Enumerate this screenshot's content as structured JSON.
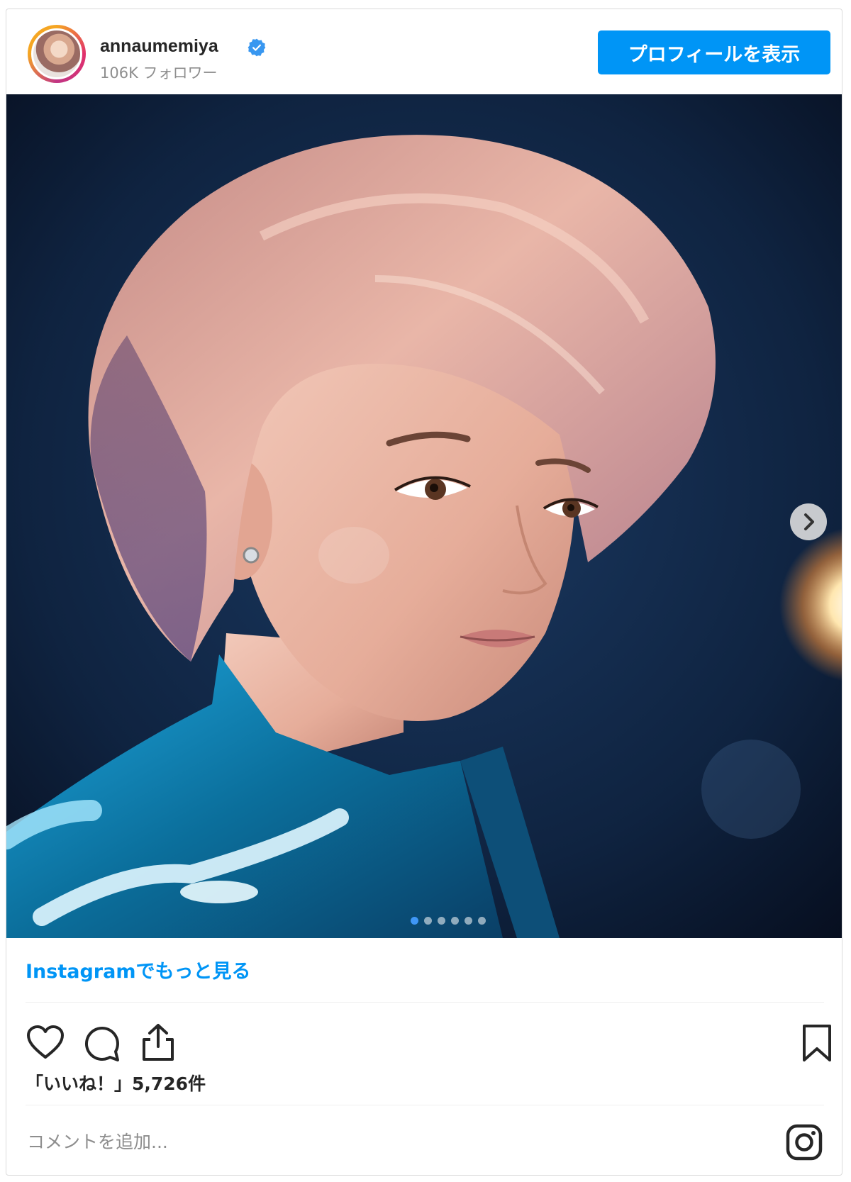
{
  "header": {
    "username": "annaumemiya",
    "followers": "106K フォロワー",
    "profile_button": "プロフィールを表示",
    "avatar_icon": "avatar-icon",
    "verified_icon": "verified-badge-icon"
  },
  "post": {
    "image_alt": "AI-generated portrait of a woman with short pink hair in a blue jacket",
    "carousel_total": 6,
    "carousel_active": 1
  },
  "footer": {
    "more_link": "Instagramでもっと見る",
    "likes": "「いいね！」5,726件",
    "comment_placeholder": "コメントを追加...",
    "icons": {
      "like": "heart-icon",
      "comment": "comment-bubble-icon",
      "share": "share-icon",
      "save": "bookmark-icon",
      "logo": "instagram-logo-icon"
    }
  },
  "colors": {
    "accent": "#0095f6",
    "text": "#262626",
    "muted": "#8e8e8e",
    "border": "#dbdbdb"
  }
}
